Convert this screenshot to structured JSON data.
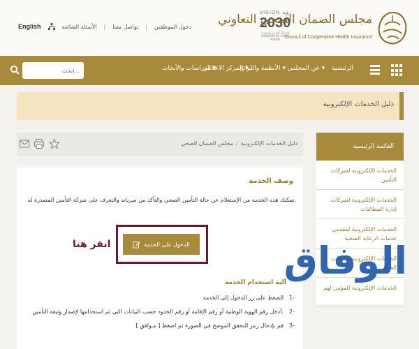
{
  "header": {
    "links": [
      "English",
      "الأسئلة الشائعة",
      "تواصل معنا",
      "دخول الموظفين"
    ],
    "vision_label": "VISION رؤية",
    "vision_year": "2030",
    "vision_sub": "المملكة العربية السعودية KINGDOM OF SAUDI ARABIA",
    "logo_ar": "مجلس الضمان الصحي التعاوني",
    "logo_en": "Council of Cooperative Health Insurance"
  },
  "nav": {
    "items": [
      "الرئيسية",
      "عن المجلس",
      "الأنظمة واللوائح",
      "المركز الاعلامي",
      "الدراسات والأبحاث"
    ],
    "search_placeholder": "إبحث..."
  },
  "page_title": "دليل الخدمات الإلكترونية",
  "breadcrumb": {
    "home": "مجلس الضمان الصحي",
    "current": "دليل الخدمات الإلكترونية",
    "separator": "/"
  },
  "service": {
    "title": "وصف الخدمة",
    "description": "تمكنك هذه الخدمة من الإستعلام عن حالة التأمين الصحي والتأكد من سريانه والتعرف على شركة التأمين المصدرة له.",
    "button_label": "الدخول على الخدمة",
    "click_here": "انقر هنا",
    "steps_title": "آلية استخدام الخدمة",
    "steps": [
      {
        "num": "1-",
        "text": "الضغط على زر الدخول إلى الخدمة"
      },
      {
        "num": "2-",
        "text": "أدخل رقم الهوية الوطنية أو رقم الإقامة أو رقم الحدود حسب البيانات التي تم استخدامها لإصدار وثيقة التأمين."
      },
      {
        "num": "3-",
        "text": "قم بإدخال رمز التحقق الموضح في الصورة ثم اضغط [ مـوافق ]"
      }
    ]
  },
  "sidebar": {
    "heading": "القائمة الرئيسية",
    "items": [
      "الخدمات الإلكترونية لشركات التأمين",
      "الخدمات الإلكترونية لشركات إدارة المطالبات",
      "الخدمات الإلكترونية لمقدمي خدمات الرعاية الصحية",
      "الخدمات الإلكترونية لأصحاب العمل",
      "الخدمات الإلكترونية للمؤمن لهم"
    ]
  },
  "watermark": "الوفاق",
  "icons": {
    "star": "star-icon",
    "print": "print-icon",
    "mail": "mail-icon",
    "search": "search-icon",
    "edit": "edit-icon",
    "menu": "hamburger-icon",
    "apps": "grid-icon",
    "sitemap": "sitemap-icon"
  },
  "colors": {
    "brand_gold": "#a88a3c",
    "title_bg": "#f4e4bf",
    "frame": "#6b1b28",
    "watermark": "#1f5aa8"
  }
}
